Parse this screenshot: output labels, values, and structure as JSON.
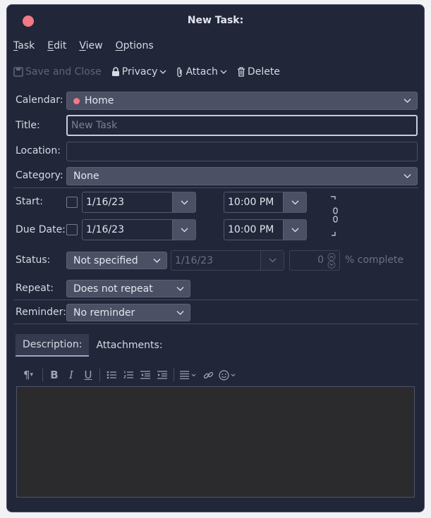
{
  "window": {
    "title": "New Task:",
    "close_color": "#f07a86"
  },
  "menu": [
    "Task",
    "Edit",
    "View",
    "Options"
  ],
  "toolbar": {
    "save_close": "Save and Close",
    "privacy": "Privacy",
    "attach": "Attach",
    "delete": "Delete"
  },
  "form": {
    "calendar_label": "Calendar:",
    "calendar_value": "Home",
    "calendar_color": "#f07a86",
    "title_label": "Title:",
    "title_placeholder": "New Task",
    "location_label": "Location:",
    "category_label": "Category:",
    "category_value": "None",
    "start_label": "Start:",
    "start_date": "1/16/23",
    "start_time": "10:00 PM",
    "due_label": "Due Date:",
    "due_date": "1/16/23",
    "due_time": "10:00 PM",
    "status_label": "Status:",
    "status_value": "Not specified",
    "status_date": "1/16/23",
    "percent_value": "0",
    "percent_label": "% complete",
    "repeat_label": "Repeat:",
    "repeat_value": "Does not repeat",
    "reminder_label": "Reminder:",
    "reminder_value": "No reminder"
  },
  "tabs": {
    "description": "Description:",
    "attachments": "Attachments:"
  }
}
